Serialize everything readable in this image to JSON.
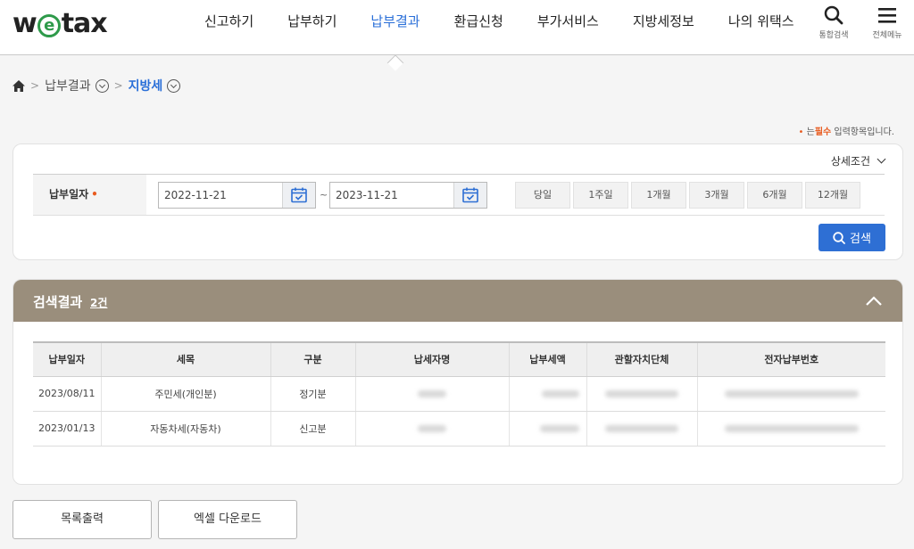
{
  "header": {
    "logo": {
      "prefix": "w",
      "mark": "e",
      "suffix": "tax"
    },
    "nav": [
      "신고하기",
      "납부하기",
      "납부결과",
      "환급신청",
      "부가서비스",
      "지방세정보",
      "나의 위택스"
    ],
    "active_nav": "납부결과",
    "search_label": "통합검색",
    "menu_label": "전체메뉴"
  },
  "breadcrumb": {
    "level1": "납부결과",
    "level2": "지방세"
  },
  "required_note": {
    "dot": "•",
    "prefix": "는",
    "required": "필수",
    "suffix": "입력항목입니다."
  },
  "search": {
    "detail_toggle": "상세조건",
    "date_label": "납부일자",
    "required_dot": "•",
    "start_date": "2022-11-21",
    "end_date": "2023-11-21",
    "tilde": "~",
    "periods": [
      "당일",
      "1주일",
      "1개월",
      "3개월",
      "6개월",
      "12개월"
    ],
    "search_button": "검색"
  },
  "results": {
    "title": "검색결과",
    "count": "2건",
    "columns": [
      "납부일자",
      "세목",
      "구분",
      "납세자명",
      "납부세액",
      "관할자치단체",
      "전자납부번호"
    ],
    "rows": [
      {
        "date": "2023/08/11",
        "tax_item": "주민세(개인분)",
        "type": "정기분"
      },
      {
        "date": "2023/01/13",
        "tax_item": "자동차세(자동차)",
        "type": "신고분"
      }
    ]
  },
  "actions": {
    "print_list": "목록출력",
    "excel_download": "엑셀 다운로드"
  },
  "colors": {
    "accent": "#2a6fd8",
    "result_header": "#9a8e7c",
    "required": "#e85b1f"
  }
}
